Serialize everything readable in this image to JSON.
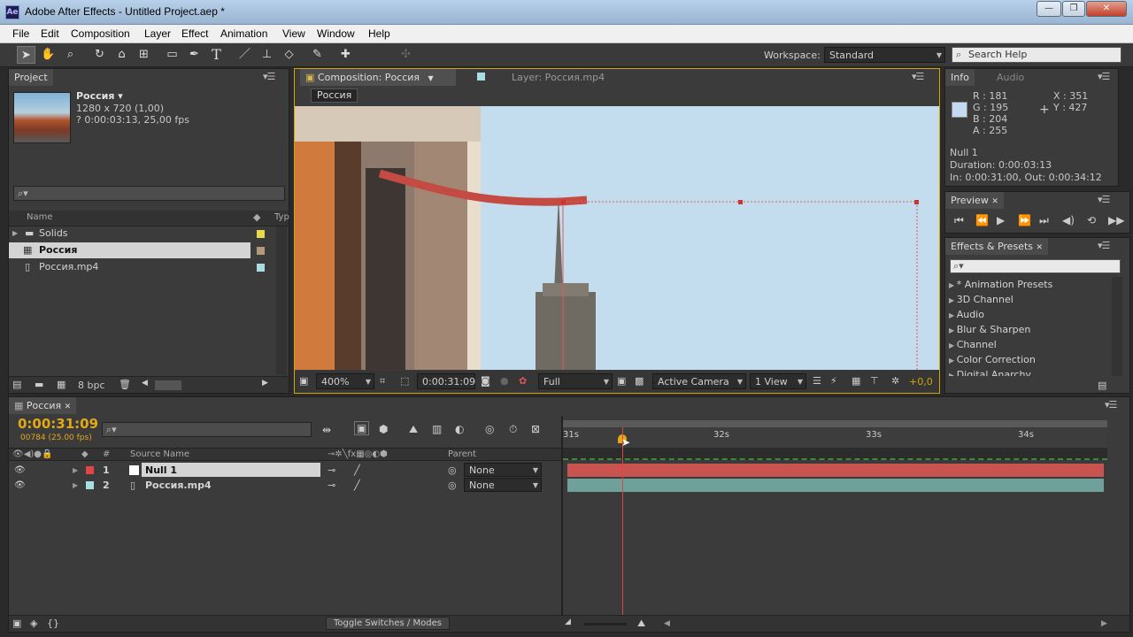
{
  "window": {
    "title": "Adobe After Effects - Untitled Project.aep *",
    "app_badge": "Ae",
    "minimize": "—",
    "maximize": "❐",
    "close": "✕"
  },
  "menu": [
    "File",
    "Edit",
    "Composition",
    "Layer",
    "Effect",
    "Animation",
    "View",
    "Window",
    "Help"
  ],
  "toolbar": {
    "workspace_label": "Workspace:",
    "workspace_value": "Standard",
    "search_placeholder": "Search Help"
  },
  "project": {
    "tab": "Project",
    "comp_name": "Россия ▾",
    "comp_dims": "1280 x 720 (1,00)",
    "comp_duration": "? 0:00:03:13, 25,00 fps",
    "col_name": "Name",
    "col_type": "Typ",
    "items": [
      {
        "name": "Solids",
        "icon": "folder-icon",
        "color": "#e8d84a"
      },
      {
        "name": "Россия",
        "icon": "composition-icon",
        "color": "#b5977a"
      },
      {
        "name": "Россия.mp4",
        "icon": "footage-icon",
        "color": "#a9dde4"
      }
    ],
    "bpc": "8 bpc"
  },
  "composition": {
    "tab": "Composition: Россия",
    "layer_tab": "Layer: Россия.mp4",
    "breadcrumb": "Россия",
    "zoom": "400%",
    "timecode": "0:00:31:09",
    "resolution": "Full",
    "camera": "Active Camera",
    "views": "1 View",
    "exposure": "+0,0"
  },
  "info": {
    "tab": "Info",
    "tab2": "Audio",
    "r": "R : 181",
    "g": "G : 195",
    "b": "B : 204",
    "a": "A : 255",
    "x": "X : 351",
    "y": "Y : 427",
    "layer": "Null 1",
    "duration": "Duration: 0:00:03:13",
    "inout": "In: 0:00:31:00, Out: 0:00:34:12",
    "swatch": "#c4daf0"
  },
  "preview": {
    "tab": "Preview"
  },
  "effects": {
    "tab": "Effects & Presets",
    "items": [
      "* Animation Presets",
      "3D Channel",
      "Audio",
      "Blur & Sharpen",
      "Channel",
      "Color Correction",
      "Digital Anarchy"
    ]
  },
  "timeline": {
    "tab": "Россия",
    "timecode": "0:00:31:09",
    "frames": "00784 (25.00 fps)",
    "col_source": "Source Name",
    "col_parent": "Parent",
    "ruler": [
      "31s",
      "32s",
      "33s",
      "34s"
    ],
    "layers": [
      {
        "num": "1",
        "name": "Null 1",
        "color": "#e04646",
        "parent": "None",
        "bar": "#c9534e"
      },
      {
        "num": "2",
        "name": "Россия.mp4",
        "color": "#a9dde4",
        "parent": "None",
        "bar": "#6fa19a"
      }
    ],
    "toggle": "Toggle Switches / Modes"
  }
}
